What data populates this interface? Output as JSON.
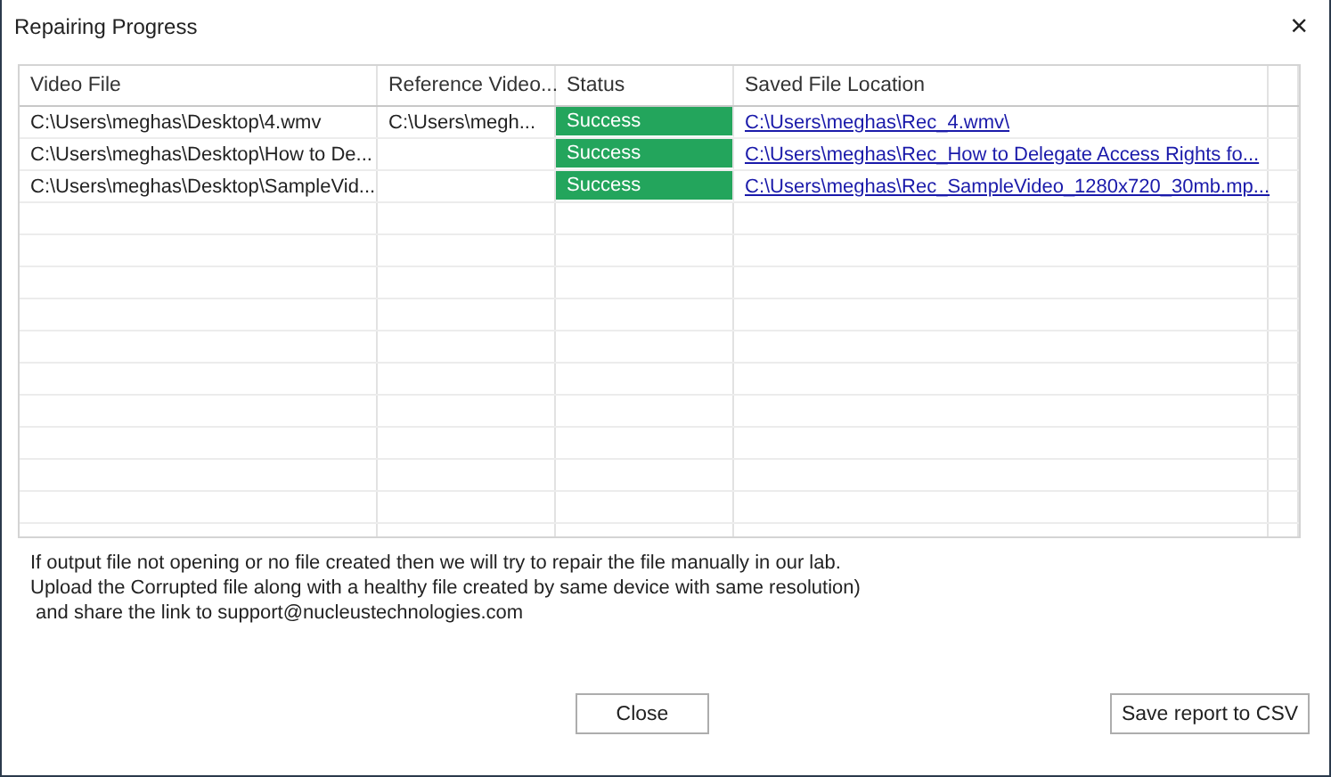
{
  "window": {
    "title": "Repairing Progress",
    "close": "×"
  },
  "table": {
    "columns": [
      "Video File",
      "Reference Video...",
      "Status",
      "Saved File Location"
    ],
    "rows": [
      {
        "video_file": "C:\\Users\\meghas\\Desktop\\4.wmv",
        "reference_video": "C:\\Users\\megh...",
        "status": "Success",
        "saved_file_location": "C:\\Users\\meghas\\Rec_4.wmv\\"
      },
      {
        "video_file": "C:\\Users\\meghas\\Desktop\\How to De...",
        "reference_video": "",
        "status": "Success",
        "saved_file_location": "C:\\Users\\meghas\\Rec_How to Delegate Access Rights fo..."
      },
      {
        "video_file": "C:\\Users\\meghas\\Desktop\\SampleVid...",
        "reference_video": "",
        "status": "Success",
        "saved_file_location": "C:\\Users\\meghas\\Rec_SampleVideo_1280x720_30mb.mp..."
      }
    ]
  },
  "note": [
    "If output file not opening or no file created then we will try to repair the file manually in our lab.",
    "Upload the Corrupted file along with a healthy file created by same device with same resolution)",
    " and share the link to support@nucleustechnologies.com"
  ],
  "buttons": [
    "Close",
    "Save report to CSV"
  ]
}
